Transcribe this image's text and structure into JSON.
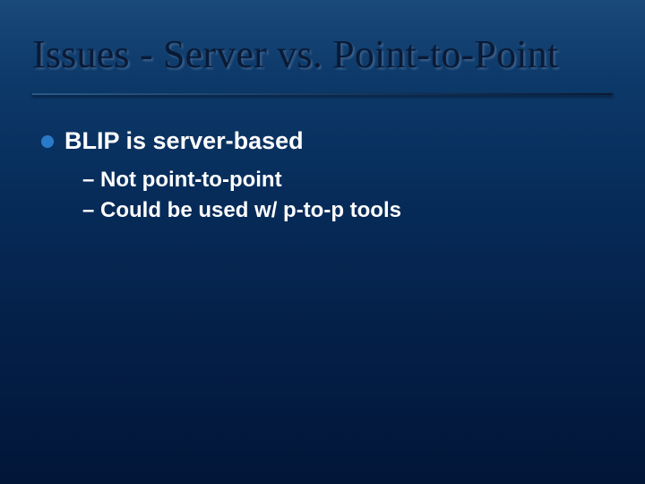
{
  "title": "Issues - Server vs. Point-to-Point",
  "bullet1": "BLIP is server-based",
  "sub1": "– Not point-to-point",
  "sub2": "– Could be used w/ p-to-p tools"
}
